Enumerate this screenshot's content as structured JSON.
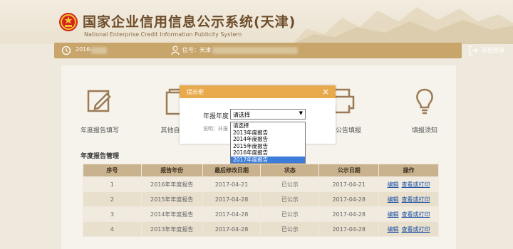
{
  "header": {
    "title_cn": "国家企业信用信息公示系统(天津)",
    "title_en": "National Enterprise Credit Information Publicity System"
  },
  "toolbar": {
    "date_prefix": "2016-",
    "user_label": "信号：天津",
    "logout_label": "退出登录"
  },
  "tiles": [
    {
      "label": "年度报告填写",
      "icon": "pen-icon"
    },
    {
      "label": "其他自行公",
      "icon": "document-icon"
    },
    {
      "label": "注销公告填报",
      "icon": "printer-icon"
    },
    {
      "label": "填报须知",
      "icon": "lightbulb-icon"
    }
  ],
  "section": {
    "title": "年度报告管理"
  },
  "table": {
    "headers": [
      "序号",
      "报告年份",
      "最后修改日期",
      "状态",
      "公示日期",
      "操作"
    ],
    "rows": [
      {
        "no": "1",
        "year": "2016年年度报告",
        "modified": "2017-04-21",
        "status": "已公示",
        "published": "2017-04-21",
        "edit": "编辑",
        "view": "查看或打印"
      },
      {
        "no": "2",
        "year": "2015年年度报告",
        "modified": "2017-04-28",
        "status": "已公示",
        "published": "2017-04-28",
        "edit": "编辑",
        "view": "查看或打印"
      },
      {
        "no": "3",
        "year": "2014年年度报告",
        "modified": "2017-04-28",
        "status": "已公示",
        "published": "2017-04-28",
        "edit": "编辑",
        "view": "查看或打印"
      },
      {
        "no": "4",
        "year": "2013年年度报告",
        "modified": "2017-04-28",
        "status": "已公示",
        "published": "2017-04-28",
        "edit": "编辑",
        "view": "查看或打印"
      }
    ]
  },
  "dialog": {
    "title": "提示框",
    "close": "×",
    "field_label": "年报年度",
    "selected": "请选择",
    "arrow": "▼",
    "hint": "说明：补报",
    "options": [
      "请选择",
      "2013年度报告",
      "2014年度报告",
      "2015年度报告",
      "2016年度报告",
      "2017年度报告"
    ],
    "highlighted_index": 5
  },
  "colors": {
    "accent": "#e9aa4e",
    "toolbar": "#c7a56b",
    "header_text": "#6d4d2c",
    "link": "#1a4fa3"
  }
}
